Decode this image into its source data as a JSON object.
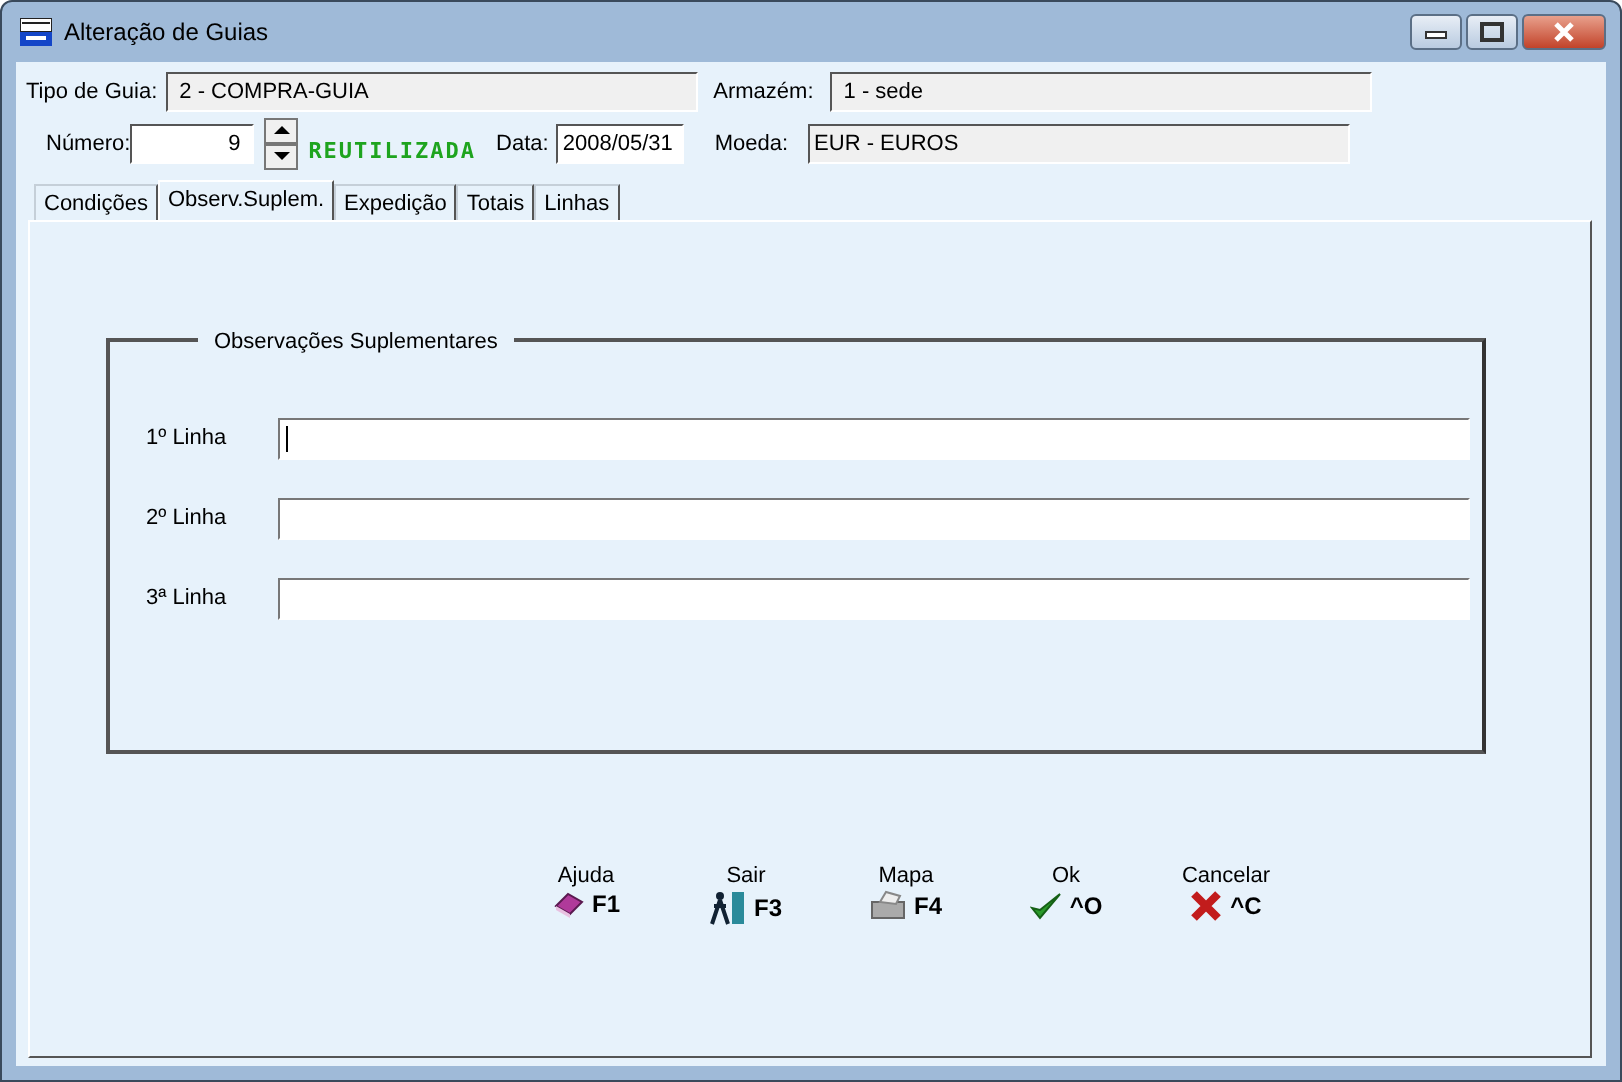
{
  "window": {
    "title": "Alteração de Guias"
  },
  "header": {
    "tipo_label": "Tipo de Guia:",
    "tipo_value": "2 - COMPRA-GUIA",
    "armazem_label": "Armazém:",
    "armazem_value": "1 - sede",
    "numero_label": "Número:",
    "numero_value": "9",
    "status": "REUTILIZADA",
    "data_label": "Data:",
    "data_value": "2008/05/31",
    "moeda_label": "Moeda:",
    "moeda_value": "EUR - EUROS"
  },
  "tabs": [
    {
      "label": "Condições",
      "selected": false
    },
    {
      "label": "Observ.Suplem.",
      "selected": true
    },
    {
      "label": "Expedição",
      "selected": false
    },
    {
      "label": "Totais",
      "selected": false
    },
    {
      "label": "Linhas",
      "selected": false
    }
  ],
  "group": {
    "title": "Observações Suplementares",
    "lines": [
      {
        "label": "1º Linha",
        "focused": true
      },
      {
        "label": "2º Linha",
        "focused": false
      },
      {
        "label": "3ª Linha",
        "focused": false
      }
    ]
  },
  "buttons": [
    {
      "label": "Ajuda",
      "key": "F1",
      "kind": "help"
    },
    {
      "label": "Sair",
      "key": "F3",
      "kind": "exit"
    },
    {
      "label": "Mapa",
      "key": "F4",
      "kind": "print"
    },
    {
      "label": "Ok",
      "key": "^O",
      "kind": "ok"
    },
    {
      "label": "Cancelar",
      "key": "^C",
      "kind": "cancel"
    }
  ]
}
